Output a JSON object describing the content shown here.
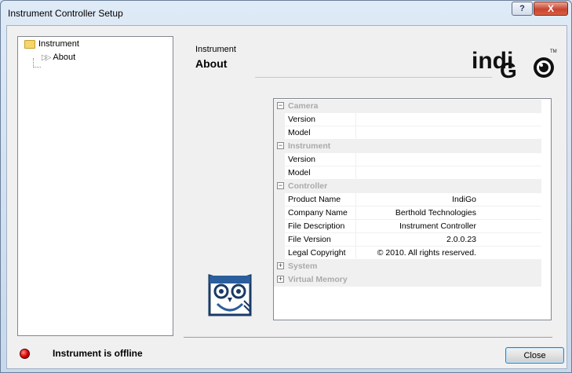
{
  "window": {
    "title": "Instrument Controller Setup",
    "help_label": "?",
    "close_label": "X"
  },
  "tree": {
    "root": "Instrument",
    "child": "About"
  },
  "header": {
    "section": "Instrument",
    "title": "About"
  },
  "logo": {
    "text": "indi",
    "tm": "TM"
  },
  "grid": {
    "categories": [
      {
        "name": "Camera",
        "sign": "⊟",
        "props": [
          {
            "name": "Version",
            "value": ""
          },
          {
            "name": "Model",
            "value": ""
          }
        ]
      },
      {
        "name": "Instrument",
        "sign": "⊟",
        "props": [
          {
            "name": "Version",
            "value": ""
          },
          {
            "name": "Model",
            "value": ""
          }
        ]
      },
      {
        "name": "Controller",
        "sign": "⊟",
        "props": [
          {
            "name": "Product Name",
            "value": "IndiGo"
          },
          {
            "name": "Company Name",
            "value": "Berthold Technologies"
          },
          {
            "name": "File Description",
            "value": "Instrument Controller"
          },
          {
            "name": "File Version",
            "value": "2.0.0.23"
          },
          {
            "name": "Legal Copyright",
            "value": "© 2010. All rights reserved."
          }
        ]
      },
      {
        "name": "System",
        "sign": "⊞",
        "props": []
      },
      {
        "name": "Virtual Memory",
        "sign": "⊞",
        "props": []
      }
    ]
  },
  "status": {
    "text": "Instrument is offline",
    "color": "#d50000"
  },
  "buttons": {
    "close": "Close"
  }
}
